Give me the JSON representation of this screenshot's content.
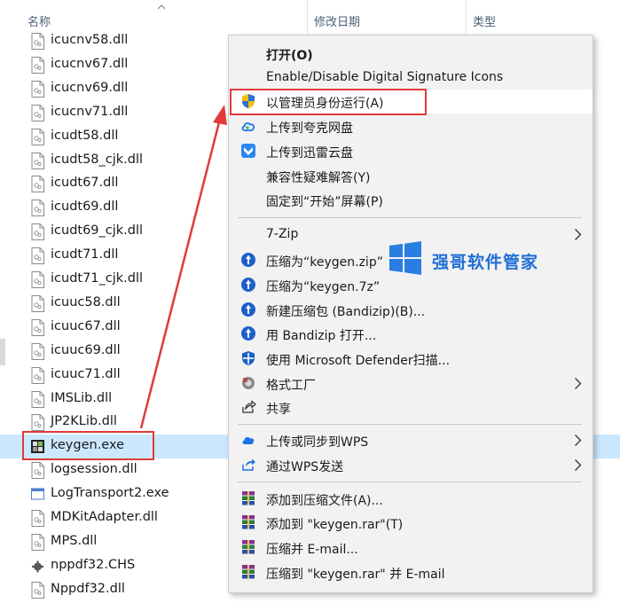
{
  "columns": {
    "name": "名称",
    "date": "修改日期",
    "type": "类型"
  },
  "files": [
    {
      "name": "icucnv58.dll",
      "icon": "dll-file-icon"
    },
    {
      "name": "icucnv67.dll",
      "icon": "dll-file-icon"
    },
    {
      "name": "icucnv69.dll",
      "icon": "dll-file-icon"
    },
    {
      "name": "icucnv71.dll",
      "icon": "dll-file-icon"
    },
    {
      "name": "icudt58.dll",
      "icon": "dll-file-icon"
    },
    {
      "name": "icudt58_cjk.dll",
      "icon": "dll-file-icon"
    },
    {
      "name": "icudt67.dll",
      "icon": "dll-file-icon"
    },
    {
      "name": "icudt69.dll",
      "icon": "dll-file-icon"
    },
    {
      "name": "icudt69_cjk.dll",
      "icon": "dll-file-icon"
    },
    {
      "name": "icudt71.dll",
      "icon": "dll-file-icon"
    },
    {
      "name": "icudt71_cjk.dll",
      "icon": "dll-file-icon"
    },
    {
      "name": "icuuc58.dll",
      "icon": "dll-file-icon"
    },
    {
      "name": "icuuc67.dll",
      "icon": "dll-file-icon"
    },
    {
      "name": "icuuc69.dll",
      "icon": "dll-file-icon"
    },
    {
      "name": "icuuc71.dll",
      "icon": "dll-file-icon"
    },
    {
      "name": "IMSLib.dll",
      "icon": "dll-file-icon"
    },
    {
      "name": "JP2KLib.dll",
      "icon": "dll-file-icon"
    },
    {
      "name": "keygen.exe",
      "icon": "exe-app-icon",
      "selected": true
    },
    {
      "name": "logsession.dll",
      "icon": "dll-file-icon"
    },
    {
      "name": "LogTransport2.exe",
      "icon": "window-app-icon"
    },
    {
      "name": "MDKitAdapter.dll",
      "icon": "dll-file-icon"
    },
    {
      "name": "MPS.dll",
      "icon": "dll-file-icon"
    },
    {
      "name": "nppdf32.CHS",
      "icon": "gear-file-icon"
    },
    {
      "name": "Nppdf32.dll",
      "icon": "dll-file-icon"
    }
  ],
  "menu": {
    "open": "打开(O)",
    "sig_icons": "Enable/Disable Digital Signature Icons",
    "run_admin": "以管理员身份运行(A)",
    "quark": "上传到夸克网盘",
    "xunlei": "上传到迅雷云盘",
    "compat": "兼容性疑难解答(Y)",
    "pin_start": "固定到“开始”屏幕(P)",
    "sevenzip": "7-Zip",
    "zip": "压缩为“keygen.zip”",
    "sevenz": "压缩为“keygen.7z”",
    "bandizip_new": "新建压缩包 (Bandizip)(B)...",
    "bandizip_open": "用 Bandizip 打开...",
    "defender": "使用 Microsoft Defender扫描...",
    "format_factory": "格式工厂",
    "share": "共享",
    "wps_sync": "上传或同步到WPS",
    "wps_send": "通过WPS发送",
    "add_archive": "添加到压缩文件(A)...",
    "add_rar": "添加到 \"keygen.rar\"(T)",
    "zip_email": "压缩并 E-mail...",
    "rar_email": "压缩到 \"keygen.rar\" 并 E-mail"
  },
  "watermark": {
    "text": "强哥软件管家"
  },
  "colors": {
    "selection": "#cce8ff",
    "highlight_box": "#e03a3a",
    "watermark": "#1f6fd6"
  }
}
